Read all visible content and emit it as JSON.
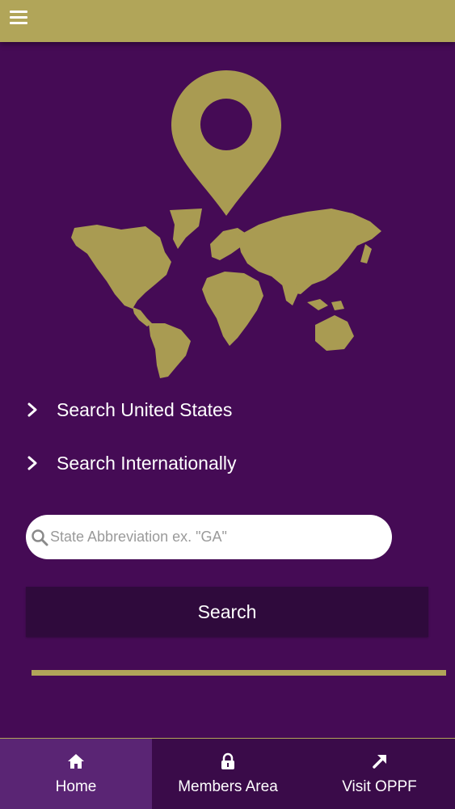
{
  "header": {
    "menu_icon": "hamburger-menu-icon",
    "background_color": "#B1A559"
  },
  "hero": {
    "graphic": "world-map-with-location-pin",
    "color": "#A99B52"
  },
  "links": [
    {
      "label": "Search United States",
      "icon": "chevron-right-icon"
    },
    {
      "label": "Search Internationally",
      "icon": "chevron-right-icon"
    }
  ],
  "search": {
    "placeholder": "State Abbreviation ex. \"GA\"",
    "value": "",
    "icon": "search-icon",
    "button_label": "Search"
  },
  "bottom_nav": {
    "tabs": [
      {
        "label": "Home",
        "icon": "home-icon",
        "active": true
      },
      {
        "label": "Members Area",
        "icon": "lock-icon",
        "active": false
      },
      {
        "label": "Visit OPPF",
        "icon": "arrow-up-right-icon",
        "active": false
      }
    ]
  },
  "colors": {
    "background": "#450B55",
    "accent_gold": "#B1A559",
    "button_dark": "#2F0A3C",
    "active_tab": "#5A2574"
  }
}
